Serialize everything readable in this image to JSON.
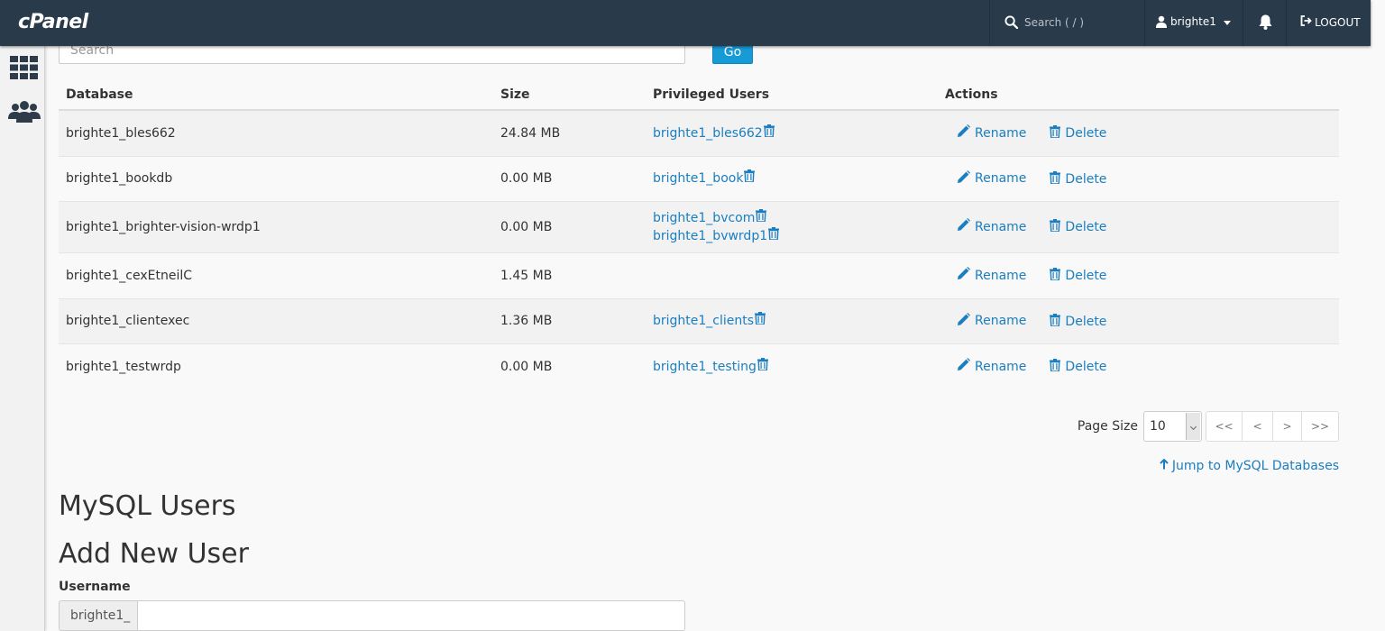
{
  "header": {
    "logo": "cPanel",
    "search_placeholder": "Search ( / )",
    "username": "brighte1",
    "logout_label": "LOGOUT"
  },
  "db_search": {
    "placeholder": "Search",
    "go_label": "Go"
  },
  "table": {
    "columns": [
      "Database",
      "Size",
      "Privileged Users",
      "Actions"
    ],
    "rename_label": "Rename",
    "delete_label": "Delete",
    "rows": [
      {
        "name": "brighte1_bles662",
        "size": "24.84 MB",
        "users": [
          "brighte1_bles662"
        ]
      },
      {
        "name": "brighte1_bookdb",
        "size": "0.00 MB",
        "users": [
          "brighte1_book"
        ]
      },
      {
        "name": "brighte1_brighter-vision-wrdp1",
        "size": "0.00 MB",
        "users": [
          "brighte1_bvcom",
          "brighte1_bvwrdp1"
        ]
      },
      {
        "name": "brighte1_cexEtneilC",
        "size": "1.45 MB",
        "users": []
      },
      {
        "name": "brighte1_clientexec",
        "size": "1.36 MB",
        "users": [
          "brighte1_clients"
        ]
      },
      {
        "name": "brighte1_testwrdp",
        "size": "0.00 MB",
        "users": [
          "brighte1_testing"
        ]
      }
    ]
  },
  "pagination": {
    "page_size_label": "Page Size",
    "page_size_value": "10",
    "first": "<<",
    "prev": "<",
    "next": ">",
    "last": ">>"
  },
  "jump_link": "Jump to MySQL Databases",
  "mysql_users_heading": "MySQL Users",
  "add_user_heading": "Add New User",
  "username_label": "Username",
  "username_prefix": "brighte1_",
  "colors": {
    "topbar": "#293a4a",
    "link": "#1a7ebf",
    "go_button": "#179bd7"
  }
}
